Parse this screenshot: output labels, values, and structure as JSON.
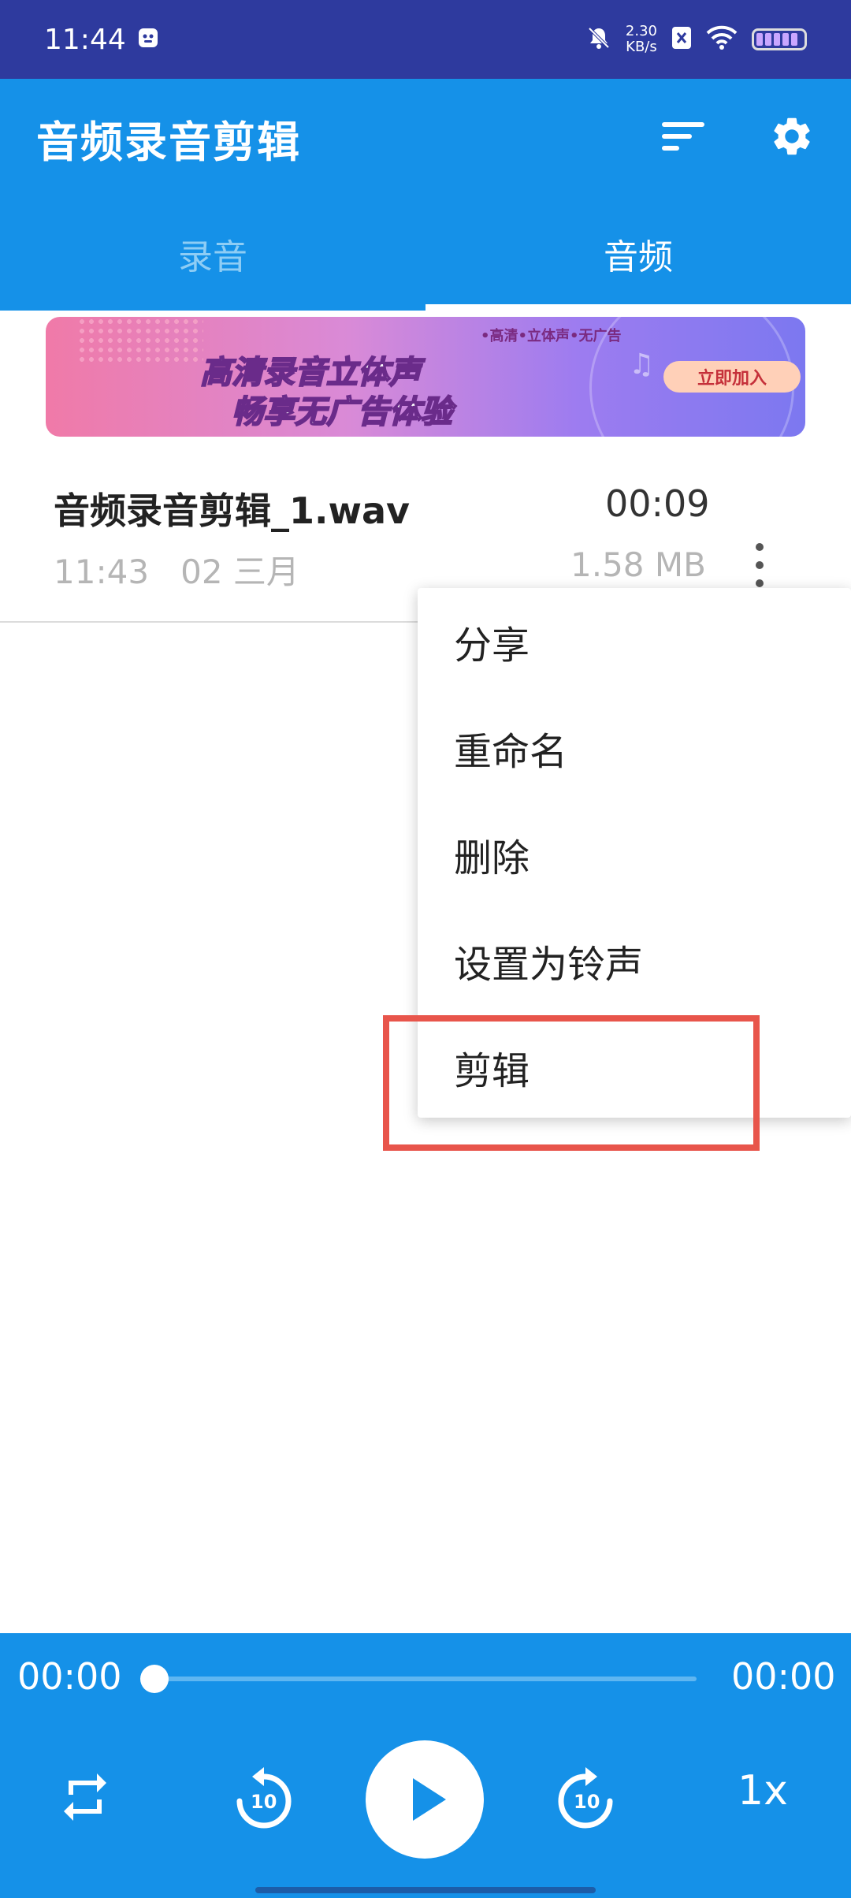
{
  "status_bar": {
    "time": "11:44",
    "net_speed_value": "2.30",
    "net_speed_unit": "KB/s"
  },
  "app_bar": {
    "title": "音频录音剪辑",
    "sort_icon": "sort-icon",
    "settings_icon": "gear-icon"
  },
  "tabs": [
    {
      "label": "录音",
      "active": false
    },
    {
      "label": "音频",
      "active": true
    }
  ],
  "banner": {
    "tag": "•高清•立体声•无广告",
    "line1": "高清录音立体声",
    "line2": "畅享无广告体验",
    "button": "立即加入"
  },
  "file_list": [
    {
      "name": "音频录音剪辑_1.wav",
      "duration": "00:09",
      "time": "11:43",
      "date": "02 三月",
      "size": "1.58 MB"
    }
  ],
  "context_menu": {
    "items": [
      "分享",
      "重命名",
      "删除",
      "设置为铃声",
      "剪辑"
    ],
    "highlighted": "剪辑"
  },
  "player": {
    "current_time": "00:00",
    "total_time": "00:00",
    "progress": 0,
    "rewind_seconds": "10",
    "forward_seconds": "10",
    "speed": "1x"
  },
  "colors": {
    "primary": "#1591E8",
    "status_bar": "#2E3A9E",
    "highlight": "#e8554b"
  }
}
